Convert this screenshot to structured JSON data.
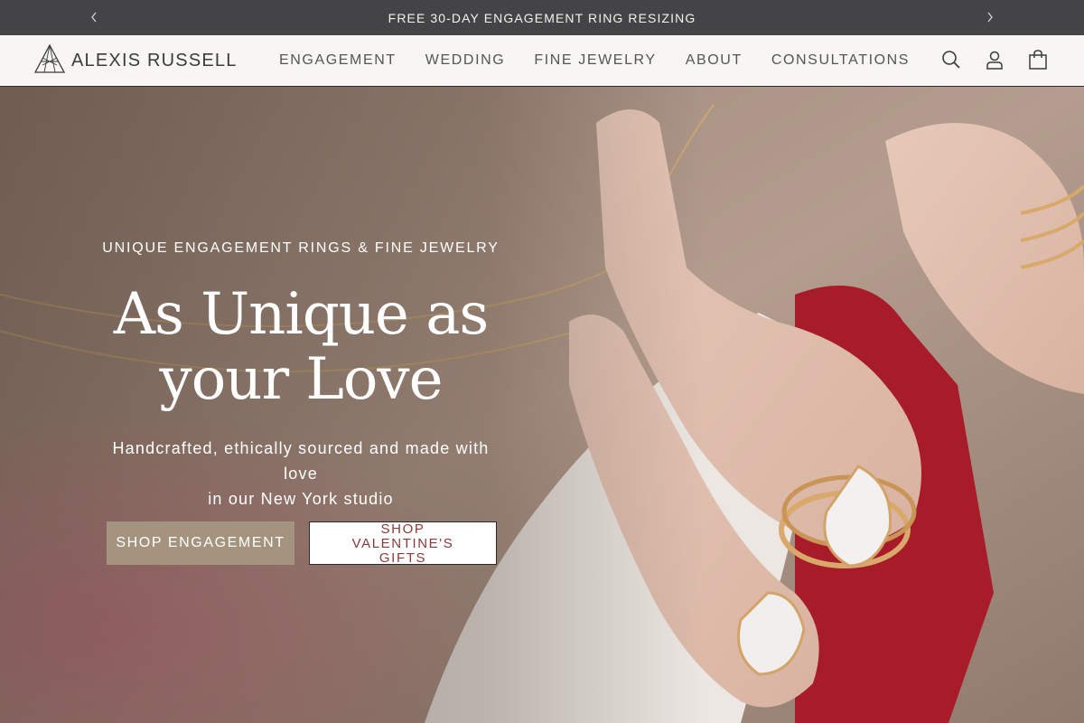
{
  "announcement": {
    "text": "FREE 30-DAY ENGAGEMENT RING RESIZING",
    "prev_icon": "chevron-left-icon",
    "next_icon": "chevron-right-icon"
  },
  "header": {
    "brand": "ALEXIS RUSSELL",
    "logo_icon": "diamond-icon",
    "nav": [
      {
        "label": "ENGAGEMENT"
      },
      {
        "label": "WEDDING"
      },
      {
        "label": "FINE JEWELRY"
      },
      {
        "label": "ABOUT"
      },
      {
        "label": "CONSULTATIONS"
      }
    ],
    "icons": [
      "search-icon",
      "account-icon",
      "cart-icon"
    ]
  },
  "hero": {
    "eyebrow": "UNIQUE ENGAGEMENT RINGS & FINE JEWELRY",
    "headline_line1": "As Unique as",
    "headline_line2": "your Love",
    "subtext_line1": "Handcrafted, ethically sourced and made with love",
    "subtext_line2": "in our New York studio",
    "primary_cta": "SHOP ENGAGEMENT",
    "secondary_cta_line1": "SHOP VALENTINE'S",
    "secondary_cta_line2": "GIFTS"
  },
  "colors": {
    "announcement_bg": "#444446",
    "header_bg": "#f7f6f2",
    "primary_button": "#a4937f",
    "secondary_button_text": "#8a3a3a"
  }
}
